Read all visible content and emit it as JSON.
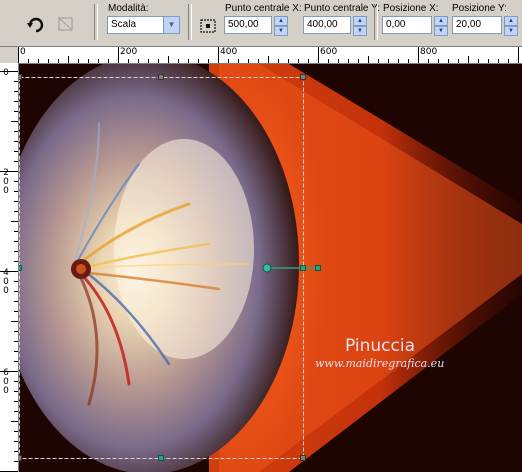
{
  "toolbar": {
    "mode_label": "Modalità:",
    "mode_value": "Scala",
    "center_x_label": "Punto centrale X:",
    "center_x_value": "500,00",
    "center_y_label": "Punto centrale Y:",
    "center_y_value": "400,00",
    "pos_x_label": "Posizione X:",
    "pos_x_value": "0,00",
    "pos_y_label": "Posizione Y:",
    "pos_y_value": "20,00"
  },
  "ruler_top": {
    "labels": [
      "0",
      "200",
      "400",
      "600",
      "800"
    ]
  },
  "ruler_left": {
    "labels": [
      "0",
      "200",
      "400",
      "600"
    ]
  },
  "canvas": {
    "watermark_name": "Pinuccia",
    "watermark_url": "www.maidiregrafica.eu"
  },
  "colors": {
    "accent_orange": "#e84010",
    "background": "#1e0502",
    "handle_green": "#30a080"
  }
}
